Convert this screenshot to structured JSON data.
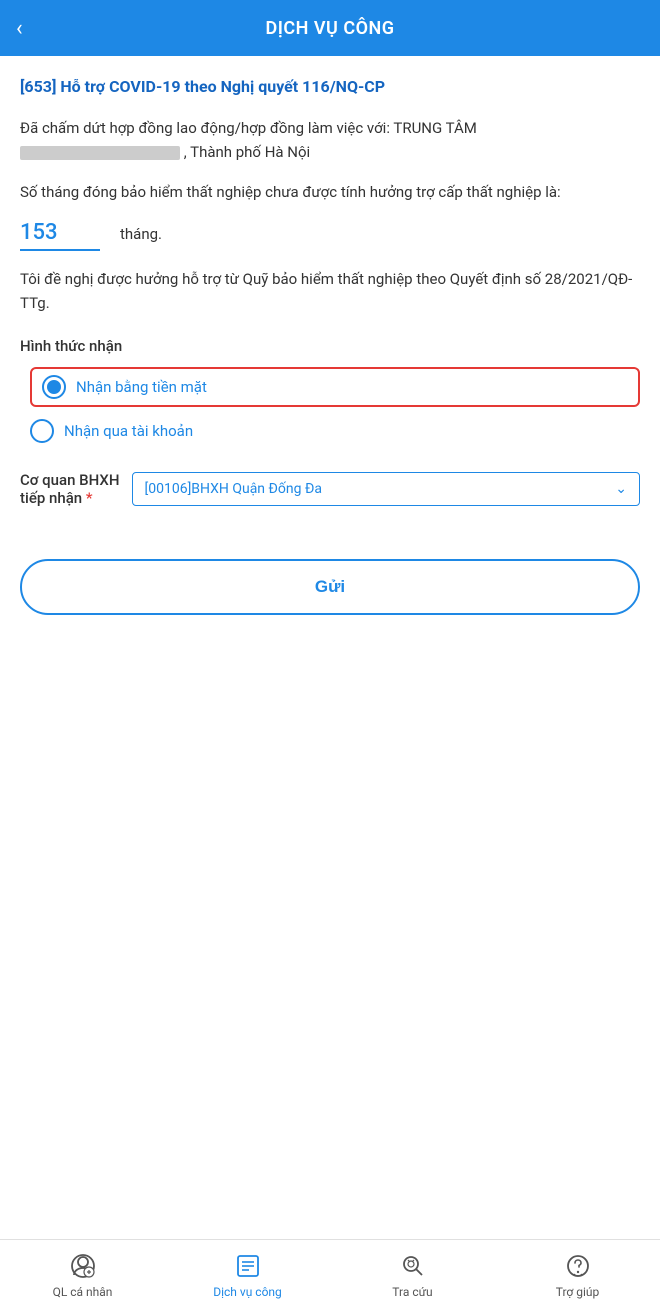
{
  "header": {
    "back_label": "‹",
    "title": "DỊCH VỤ CÔNG"
  },
  "content": {
    "section_title": "[653] Hỗ trợ COVID-19 theo Nghị quyết 116/NQ-CP",
    "paragraph1_part1": "Đã chấm dứt hợp đồng  lao động/hợp đồng làm việc với: TRUNG TÂM",
    "paragraph1_part2": ", Thành phố Hà Nội",
    "paragraph2": "Số tháng đóng bảo hiểm thất nghiệp chưa được tính hưởng trợ cấp thất nghiệp là:",
    "months_value": "153",
    "months_unit": "tháng.",
    "support_text": "Tôi đề nghị được hưởng hỗ trợ từ Quỹ bảo hiểm thất nghiệp theo Quyết định số 28/2021/QĐ-TTg.",
    "hinh_thuc_label": "Hình thức nhận",
    "radio_options": [
      {
        "id": "cash",
        "label": "Nhận bằng tiền mặt",
        "selected": true
      },
      {
        "id": "account",
        "label": "Nhận qua tài khoản",
        "selected": false
      }
    ],
    "co_quan_label": "Cơ quan BHXH\ntiếp nhận",
    "required_star": "*",
    "dropdown_value": "[00106]BHXH Quận Đống Đa",
    "submit_label": "Gửi"
  },
  "bottom_nav": {
    "items": [
      {
        "id": "ql-ca-nhan",
        "label": "QL cá nhân"
      },
      {
        "id": "dich-vu-cong",
        "label": "Dịch vụ công",
        "active": true
      },
      {
        "id": "tra-cuu",
        "label": "Tra cứu"
      },
      {
        "id": "tro-giup",
        "label": "Trợ giúp"
      }
    ]
  }
}
